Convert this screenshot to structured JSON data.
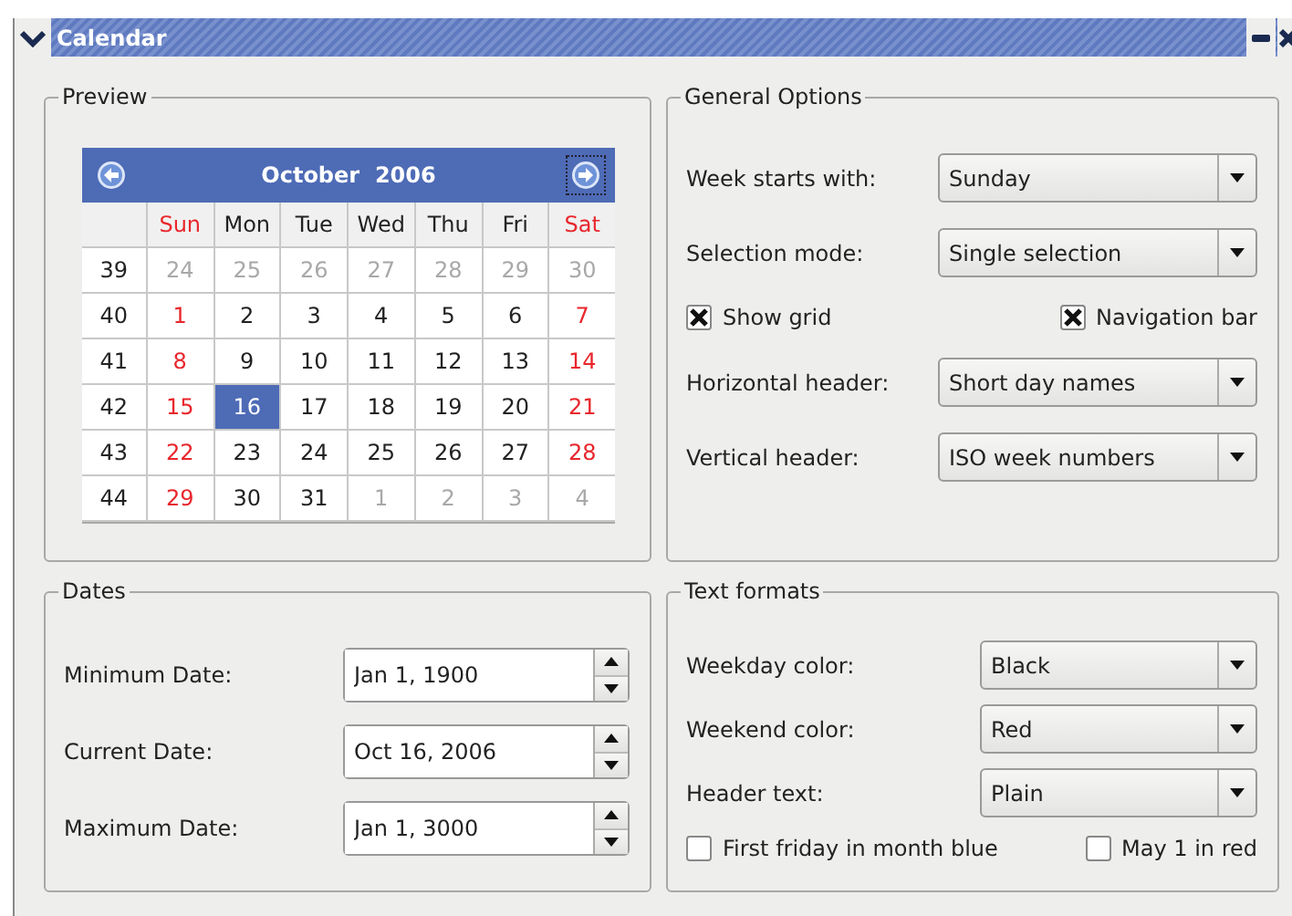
{
  "window": {
    "title": "Calendar"
  },
  "preview": {
    "title": "Preview",
    "month": "October  2006",
    "weekdays": [
      {
        "label": "Sun",
        "weekend": true
      },
      {
        "label": "Mon",
        "weekend": false
      },
      {
        "label": "Tue",
        "weekend": false
      },
      {
        "label": "Wed",
        "weekend": false
      },
      {
        "label": "Thu",
        "weekend": false
      },
      {
        "label": "Fri",
        "weekend": false
      },
      {
        "label": "Sat",
        "weekend": true
      }
    ],
    "weeks": [
      {
        "week": "39",
        "days": [
          {
            "day": "24",
            "kind": "other"
          },
          {
            "day": "25",
            "kind": "other"
          },
          {
            "day": "26",
            "kind": "other"
          },
          {
            "day": "27",
            "kind": "other"
          },
          {
            "day": "28",
            "kind": "other"
          },
          {
            "day": "29",
            "kind": "other"
          },
          {
            "day": "30",
            "kind": "other"
          }
        ]
      },
      {
        "week": "40",
        "days": [
          {
            "day": "1",
            "kind": "weekend"
          },
          {
            "day": "2",
            "kind": "weekday"
          },
          {
            "day": "3",
            "kind": "weekday"
          },
          {
            "day": "4",
            "kind": "weekday"
          },
          {
            "day": "5",
            "kind": "weekday"
          },
          {
            "day": "6",
            "kind": "weekday"
          },
          {
            "day": "7",
            "kind": "weekend"
          }
        ]
      },
      {
        "week": "41",
        "days": [
          {
            "day": "8",
            "kind": "weekend"
          },
          {
            "day": "9",
            "kind": "weekday"
          },
          {
            "day": "10",
            "kind": "weekday"
          },
          {
            "day": "11",
            "kind": "weekday"
          },
          {
            "day": "12",
            "kind": "weekday"
          },
          {
            "day": "13",
            "kind": "weekday"
          },
          {
            "day": "14",
            "kind": "weekend"
          }
        ]
      },
      {
        "week": "42",
        "days": [
          {
            "day": "15",
            "kind": "weekend"
          },
          {
            "day": "16",
            "kind": "selected"
          },
          {
            "day": "17",
            "kind": "weekday"
          },
          {
            "day": "18",
            "kind": "weekday"
          },
          {
            "day": "19",
            "kind": "weekday"
          },
          {
            "day": "20",
            "kind": "weekday"
          },
          {
            "day": "21",
            "kind": "weekend"
          }
        ]
      },
      {
        "week": "43",
        "days": [
          {
            "day": "22",
            "kind": "weekend"
          },
          {
            "day": "23",
            "kind": "weekday"
          },
          {
            "day": "24",
            "kind": "weekday"
          },
          {
            "day": "25",
            "kind": "weekday"
          },
          {
            "day": "26",
            "kind": "weekday"
          },
          {
            "day": "27",
            "kind": "weekday"
          },
          {
            "day": "28",
            "kind": "weekend"
          }
        ]
      },
      {
        "week": "44",
        "days": [
          {
            "day": "29",
            "kind": "weekend"
          },
          {
            "day": "30",
            "kind": "weekday"
          },
          {
            "day": "31",
            "kind": "weekday"
          },
          {
            "day": "1",
            "kind": "other"
          },
          {
            "day": "2",
            "kind": "other"
          },
          {
            "day": "3",
            "kind": "other"
          },
          {
            "day": "4",
            "kind": "other"
          }
        ]
      }
    ]
  },
  "general_options": {
    "title": "General Options",
    "week_starts": {
      "label": "Week starts with:",
      "value": "Sunday"
    },
    "selection_mode": {
      "label": "Selection mode:",
      "value": "Single selection"
    },
    "show_grid": {
      "label": "Show grid",
      "checked": true
    },
    "navigation_bar": {
      "label": "Navigation bar",
      "checked": true
    },
    "horizontal_header": {
      "label": "Horizontal header:",
      "value": "Short day names"
    },
    "vertical_header": {
      "label": "Vertical header:",
      "value": "ISO week numbers"
    }
  },
  "dates": {
    "title": "Dates",
    "fields": [
      {
        "label": "Minimum Date:",
        "value": "Jan 1, 1900"
      },
      {
        "label": "Current Date:",
        "value": "Oct 16, 2006"
      },
      {
        "label": "Maximum Date:",
        "value": "Jan 1, 3000"
      }
    ]
  },
  "text_formats": {
    "title": "Text formats",
    "combos": [
      {
        "label": "Weekday color:",
        "value": "Black"
      },
      {
        "label": "Weekend color:",
        "value": "Red"
      },
      {
        "label": "Header text:",
        "value": "Plain"
      }
    ],
    "first_friday": {
      "label": "First friday in month blue",
      "checked": false
    },
    "may_first": {
      "label": "May 1 in red",
      "checked": false
    }
  }
}
